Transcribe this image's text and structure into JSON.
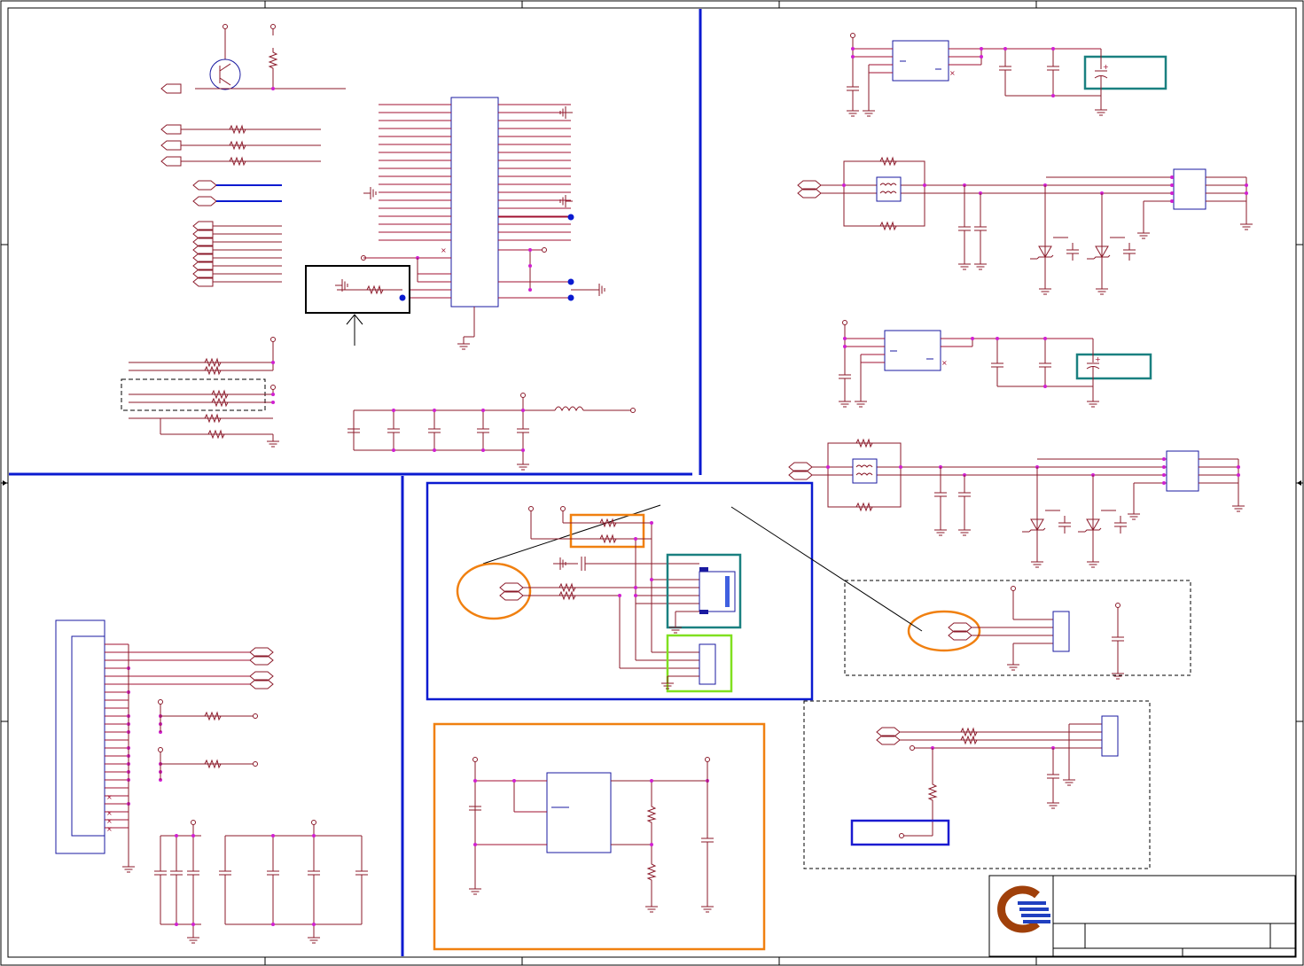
{
  "colors": {
    "wire": "#8b1a2a",
    "component_outline": "#1a1aa0",
    "bus_divider": "#0a1ad0",
    "junction": "#d020d0",
    "highlight_orange": "#f08010",
    "highlight_teal": "#1a8080",
    "highlight_green": "#80e020",
    "logo_brown": "#a0400a",
    "logo_blue": "#2040c0"
  },
  "icons": [
    "company-logo",
    "resistor-symbol",
    "capacitor-symbol",
    "ground-symbol",
    "transistor-symbol",
    "zener-diode-symbol",
    "inductor-symbol",
    "connector-symbol",
    "arrow-annotation"
  ],
  "title_block": {
    "logo": "company-logo"
  }
}
